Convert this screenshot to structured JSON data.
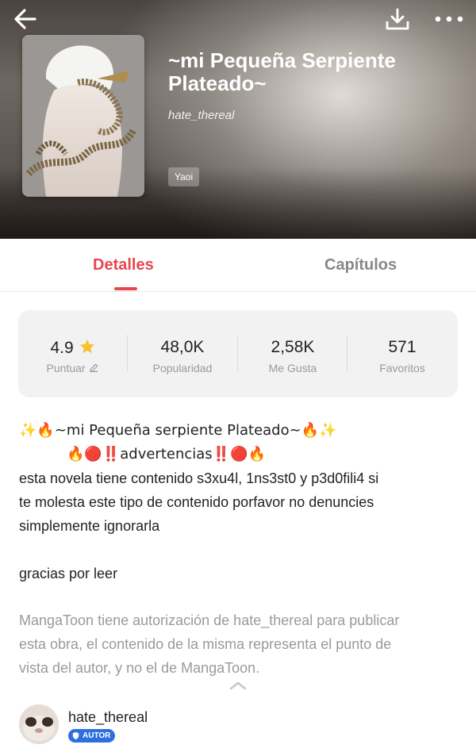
{
  "header": {
    "title": "~mi Pequeña Serpiente Plateado~",
    "author": "hate_thereal",
    "genre_tag": "Yaoi",
    "icons": [
      "back-arrow-icon",
      "download-icon",
      "more-options-icon"
    ]
  },
  "tabs": {
    "details": "Detalles",
    "chapters": "Capítulos",
    "active": "Detalles",
    "accent_color": "#e8464e"
  },
  "stats": {
    "rating": {
      "value": "4.9",
      "label": "Puntuar"
    },
    "popularity": {
      "value": "48,0K",
      "label": "Popularidad"
    },
    "likes": {
      "value": "2,58K",
      "label": "Me Gusta"
    },
    "favorites": {
      "value": "571",
      "label": "Favoritos"
    }
  },
  "description": {
    "line1": "✨🔥~mi Pequeña serpiente Plateado~🔥✨",
    "line2": "🔥🔴‼️advertencias‼️🔴🔥",
    "line3": "esta novela tiene contenido s3xu4l, 1ns3st0 y p3d0fili4 si",
    "line4": "te molesta este tipo de contenido porfavor no denuncies",
    "line5": "simplemente ignorarla",
    "line6": "gracias por leer"
  },
  "disclaimer": {
    "line1": "MangaToon tiene autorización de hate_thereal para publicar",
    "line2": "esta obra, el contenido de la misma representa el punto de",
    "line3": "vista del autor, y no el de MangaToon."
  },
  "author_row": {
    "name": "hate_thereal",
    "badge": "AUTOR",
    "badge_color": "#2e6fe0"
  }
}
